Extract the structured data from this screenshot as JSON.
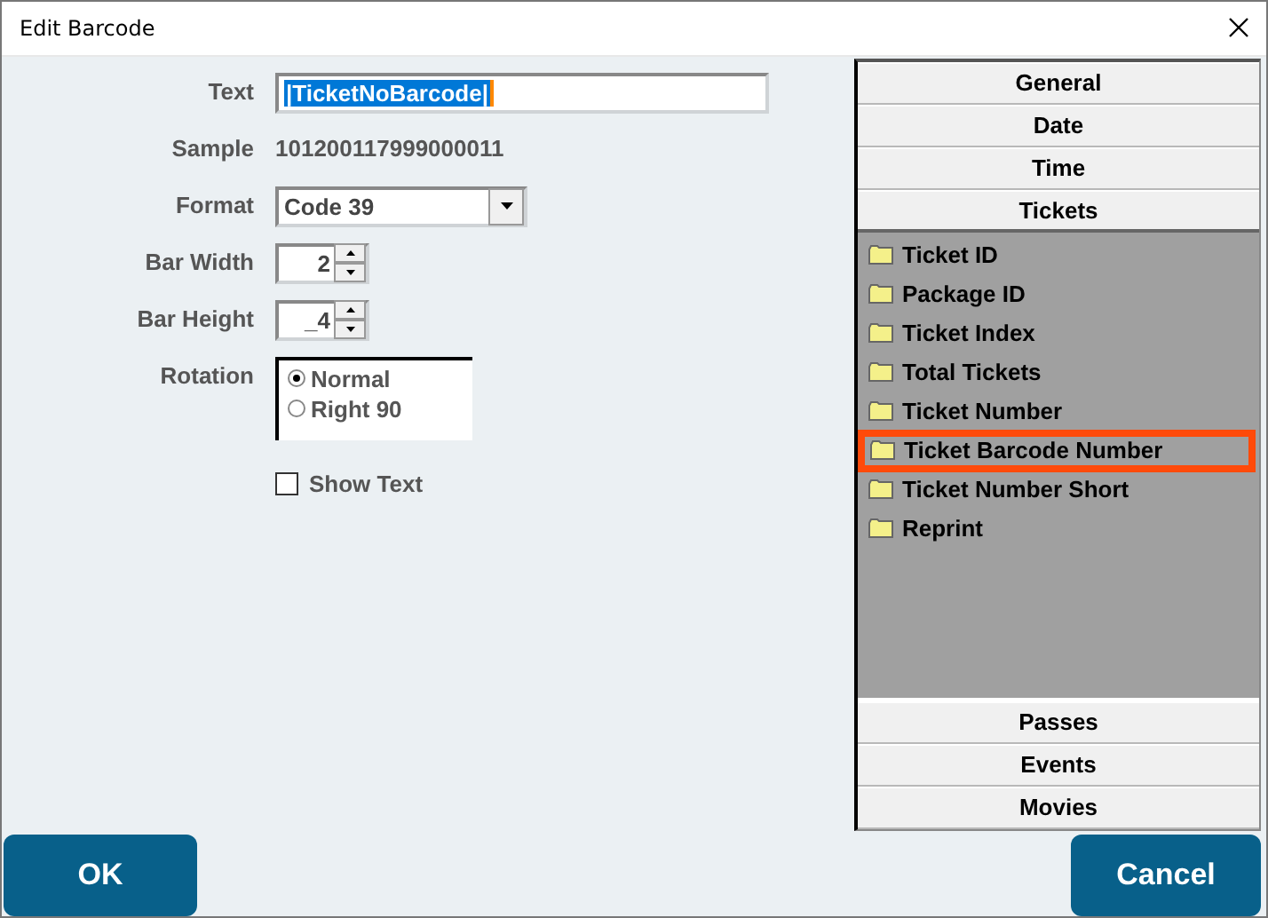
{
  "window": {
    "title": "Edit Barcode"
  },
  "form": {
    "text": {
      "label": "Text",
      "value": "|TicketNoBarcode|",
      "selected": true
    },
    "sample": {
      "label": "Sample",
      "value": "101200117999000011"
    },
    "format": {
      "label": "Format",
      "value": "Code 39"
    },
    "bar_width": {
      "label": "Bar Width",
      "value": "2"
    },
    "bar_height": {
      "label": "Bar Height",
      "value": "_4"
    },
    "rotation": {
      "label": "Rotation",
      "options": [
        {
          "label": "Normal",
          "selected": true
        },
        {
          "label": "Right 90",
          "selected": false
        }
      ]
    },
    "show_text": {
      "label": "Show Text",
      "checked": false
    }
  },
  "categories": [
    {
      "label": "General",
      "expanded": false
    },
    {
      "label": "Date",
      "expanded": false
    },
    {
      "label": "Time",
      "expanded": false
    },
    {
      "label": "Tickets",
      "expanded": true,
      "items": [
        {
          "label": "Ticket ID",
          "selected": false
        },
        {
          "label": "Package ID",
          "selected": false
        },
        {
          "label": "Ticket Index",
          "selected": false
        },
        {
          "label": "Total Tickets",
          "selected": false
        },
        {
          "label": "Ticket Number",
          "selected": false
        },
        {
          "label": "Ticket Barcode Number",
          "selected": true
        },
        {
          "label": "Ticket Number Short",
          "selected": false
        },
        {
          "label": "Reprint",
          "selected": false
        }
      ]
    },
    {
      "label": "Passes",
      "expanded": false
    },
    {
      "label": "Events",
      "expanded": false
    },
    {
      "label": "Movies",
      "expanded": false
    }
  ],
  "buttons": [
    {
      "label": "OK"
    },
    {
      "label": "Cancel"
    }
  ]
}
